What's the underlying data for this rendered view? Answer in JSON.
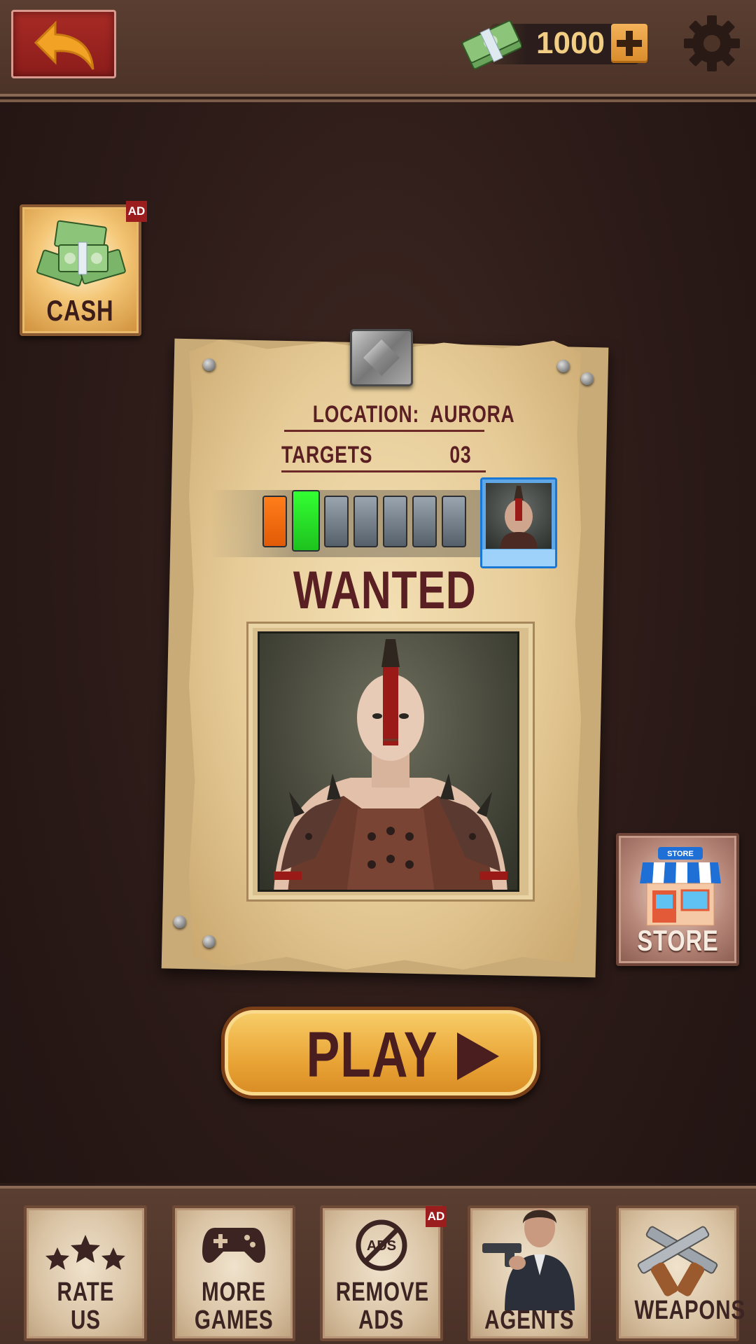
{
  "header": {
    "back_button": "back-arrow-icon",
    "cash_amount": "1000",
    "add_cash_icon": "plus-icon",
    "settings_icon": "gear-icon"
  },
  "side_buttons": {
    "cash": {
      "label": "CASH",
      "badge": "AD"
    },
    "store": {
      "label": "STORE",
      "sign": "STORE"
    }
  },
  "poster": {
    "location": "LOCATION:  AURORA",
    "targets_label": "TARGETS",
    "targets_value": "03",
    "title": "WANTED",
    "progress": {
      "total_segments": 7,
      "completed": 1,
      "current": 2
    }
  },
  "play": {
    "label": "PLAY"
  },
  "bottom_menu": {
    "rate": {
      "line1": "RATE",
      "line2": "US"
    },
    "more_games": {
      "line1": "MORE",
      "line2": "GAMES"
    },
    "remove_ads": {
      "line1": "REMOVE",
      "line2": "ADS",
      "badge": "AD",
      "icon_text": "ADS"
    },
    "agents": {
      "label": "AGENTS"
    },
    "weapons": {
      "label": "WEAPONS"
    }
  },
  "colors": {
    "accent_gold": "#e9a436",
    "poster_ink": "#5a1f22",
    "progress_done": "#e25a06",
    "progress_current": "#1ec21e",
    "progress_pending": "#56606a",
    "thumb_border": "#1a78d4"
  }
}
